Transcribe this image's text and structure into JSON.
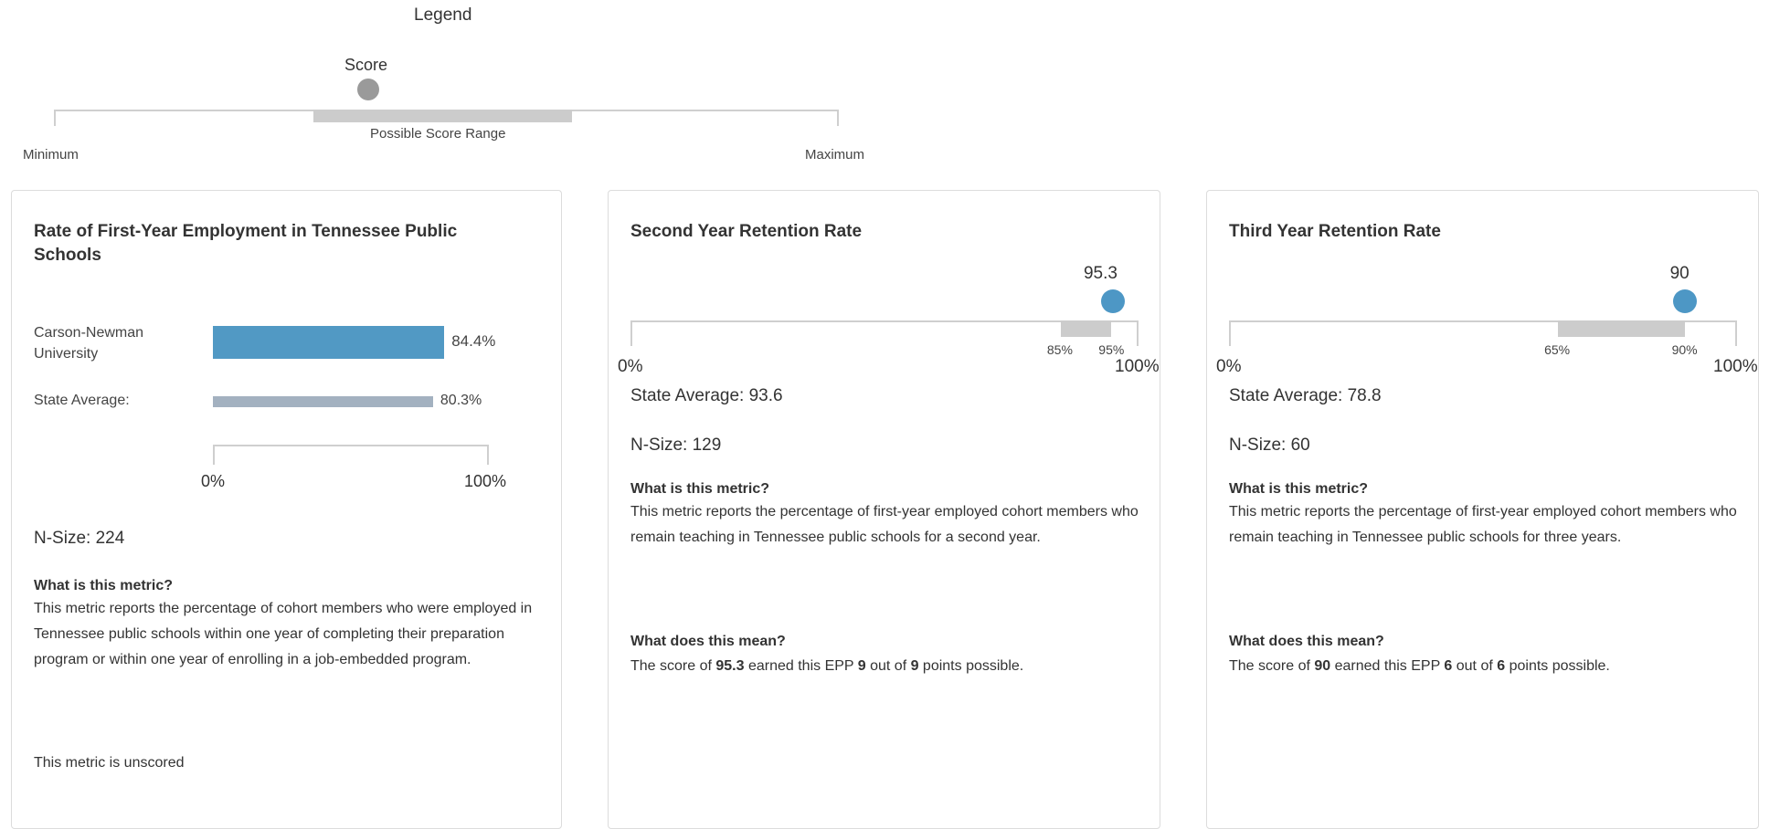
{
  "legend": {
    "title": "Legend",
    "score_label": "Score",
    "range_label": "Possible Score Range",
    "min_label": "Minimum",
    "max_label": "Maximum"
  },
  "colors": {
    "score_blue": "#4d97c5",
    "bar_blue": "#5199c4",
    "state_bar": "#a3b1c0",
    "band_gray": "#cccccc",
    "legend_dot": "#9a9a9a"
  },
  "cards": [
    {
      "title": "Rate of First-Year Employment in Tennessee Public Schools",
      "bars": [
        {
          "label": "Carson-Newman University",
          "value": 84.4,
          "value_label": "84.4%"
        },
        {
          "label": "State Average:",
          "value": 80.3,
          "value_label": "80.3%"
        }
      ],
      "axis_min_label": "0%",
      "axis_max_label": "100%",
      "nsize": "N-Size: 224",
      "what_heading": "What is this metric?",
      "what_text": "This metric reports the percentage of cohort members who were employed in Tennessee public schools within one year of completing their preparation program or within one year of enrolling in a job-embedded program.",
      "footer": "This metric is unscored"
    },
    {
      "title": "Second Year Retention Rate",
      "score": 95.3,
      "score_label": "95.3",
      "range_low": 85,
      "range_high": 95,
      "range_low_label": "85%",
      "range_high_label": "95%",
      "axis_min_label": "0%",
      "axis_max_label": "100%",
      "state_avg": "State Average: 93.6",
      "nsize": "N-Size: 129",
      "what_heading": "What is this metric?",
      "what_text": "This metric reports the percentage of first-year employed cohort members who remain teaching in Tennessee public schools for a second year.",
      "mean_heading": "What does this mean?",
      "mean_prefix": "The score of ",
      "mean_score": "95.3",
      "mean_mid": " earned this EPP ",
      "mean_earned": "9",
      "mean_mid2": " out of ",
      "mean_possible": "9",
      "mean_suffix": " points possible."
    },
    {
      "title": "Third Year Retention Rate",
      "score": 90,
      "score_label": "90",
      "range_low": 65,
      "range_high": 90,
      "range_low_label": "65%",
      "range_high_label": "90%",
      "axis_min_label": "0%",
      "axis_max_label": "100%",
      "state_avg": "State Average: 78.8",
      "nsize": "N-Size: 60",
      "what_heading": "What is this metric?",
      "what_text": "This metric reports the percentage of first-year employed cohort members who remain teaching in Tennessee public schools for three years.",
      "mean_heading": "What does this mean?",
      "mean_prefix": "The score of ",
      "mean_score": "90",
      "mean_mid": " earned this EPP ",
      "mean_earned": "6",
      "mean_mid2": " out of ",
      "mean_possible": "6",
      "mean_suffix": " points possible."
    }
  ]
}
